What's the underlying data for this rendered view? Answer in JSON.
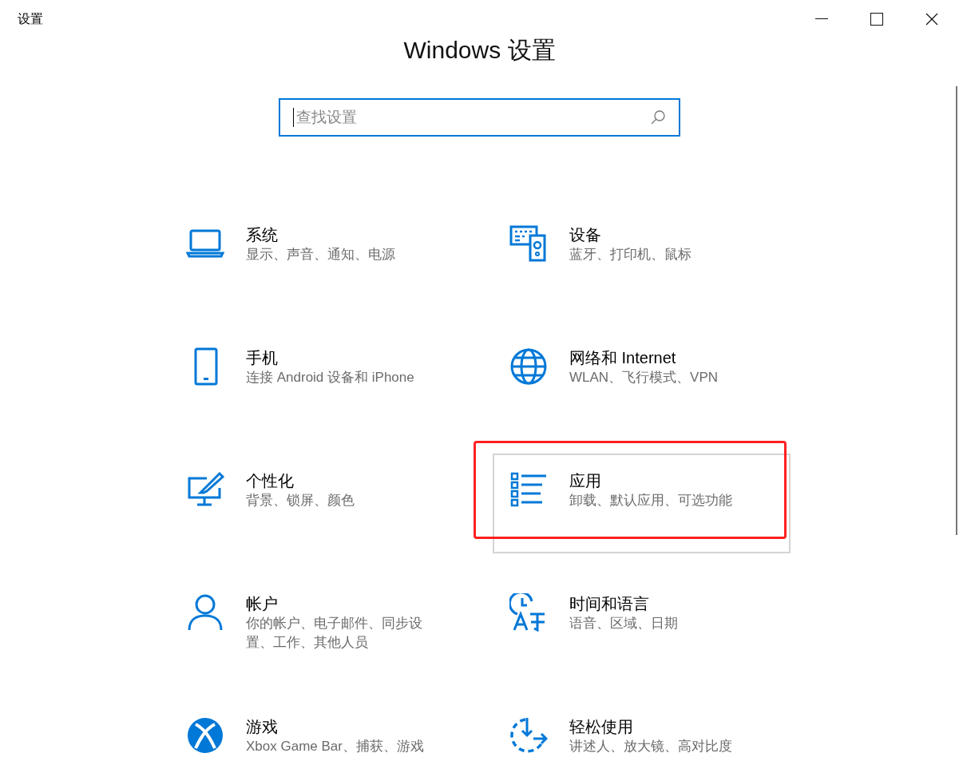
{
  "window": {
    "title": "设置"
  },
  "heading": "Windows 设置",
  "search": {
    "placeholder": "查找设置"
  },
  "categories": [
    {
      "title": "系统",
      "subtitle": "显示、声音、通知、电源",
      "selected": false,
      "annotated": false
    },
    {
      "title": "设备",
      "subtitle": "蓝牙、打印机、鼠标",
      "selected": false,
      "annotated": false
    },
    {
      "title": "手机",
      "subtitle": "连接 Android 设备和 iPhone",
      "selected": false,
      "annotated": false
    },
    {
      "title": "网络和 Internet",
      "subtitle": "WLAN、飞行模式、VPN",
      "selected": false,
      "annotated": false
    },
    {
      "title": "个性化",
      "subtitle": "背景、锁屏、颜色",
      "selected": false,
      "annotated": false
    },
    {
      "title": "应用",
      "subtitle": "卸载、默认应用、可选功能",
      "selected": true,
      "annotated": true
    },
    {
      "title": "帐户",
      "subtitle": "你的帐户、电子邮件、同步设置、工作、其他人员",
      "selected": false,
      "annotated": false
    },
    {
      "title": "时间和语言",
      "subtitle": "语音、区域、日期",
      "selected": false,
      "annotated": false
    },
    {
      "title": "游戏",
      "subtitle": "Xbox Game Bar、捕获、游戏",
      "selected": false,
      "annotated": false
    },
    {
      "title": "轻松使用",
      "subtitle": "讲述人、放大镜、高对比度",
      "selected": false,
      "annotated": false
    }
  ]
}
